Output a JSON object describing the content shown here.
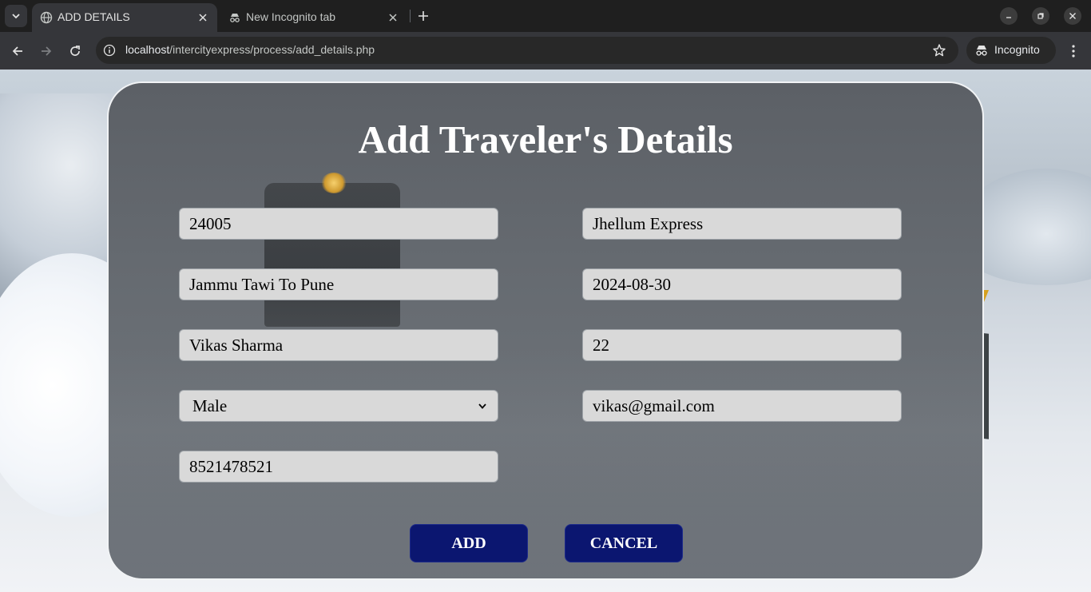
{
  "browser": {
    "tabs": [
      {
        "title": "ADD DETAILS",
        "icon": "globe-icon",
        "active": true
      },
      {
        "title": "New Incognito tab",
        "icon": "incognito-icon",
        "active": false
      }
    ],
    "url_host": "localhost",
    "url_path": "/intercityexpress/process/add_details.php",
    "profile_label": "Incognito"
  },
  "form": {
    "heading": "Add Traveler's Details",
    "train_number": "24005",
    "train_name": "Jhellum Express",
    "route": "Jammu Tawi To Pune",
    "travel_date": "2024-08-30",
    "name": "Vikas Sharma",
    "age": "22",
    "gender": "Male",
    "email": "vikas@gmail.com",
    "phone": "8521478521",
    "add_label": "ADD",
    "cancel_label": "CANCEL"
  },
  "colors": {
    "button_bg": "#0b1670",
    "field_bg": "#d9d9d9",
    "heading": "#ffffff"
  }
}
